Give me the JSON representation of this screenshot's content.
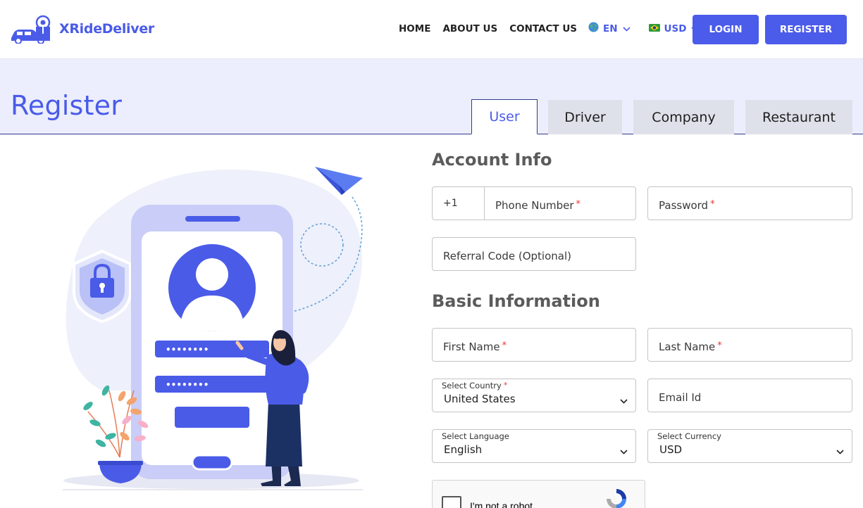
{
  "brand": {
    "name": "XRideDeliver"
  },
  "nav": {
    "home": "HOME",
    "about": "ABOUT US",
    "contact": "CONTACT US",
    "language": "EN",
    "currency": "USD",
    "login": "LOGIN",
    "register": "REGISTER"
  },
  "page": {
    "title": "Register"
  },
  "tabs": [
    {
      "label": "User",
      "active": true
    },
    {
      "label": "Driver",
      "active": false
    },
    {
      "label": "Company",
      "active": false
    },
    {
      "label": "Restaurant",
      "active": false
    }
  ],
  "account_info": {
    "heading": "Account Info",
    "phone_code": "+1",
    "phone_placeholder": "Phone Number",
    "password_placeholder": "Password",
    "referral_placeholder": "Referral Code (Optional)"
  },
  "basic_info": {
    "heading": "Basic Information",
    "first_name_placeholder": "First Name",
    "last_name_placeholder": "Last Name",
    "country_label": "Select Country",
    "country_value": "United States",
    "email_placeholder": "Email Id",
    "language_label": "Select Language",
    "language_value": "English",
    "currency_label": "Select Currency",
    "currency_value": "USD"
  },
  "captcha": {
    "label": "I'm not a robot"
  },
  "illustration": {
    "password_mask_1": "••••••••",
    "password_mask_2": "••••••••"
  },
  "colors": {
    "accent": "#4b5bea",
    "banner": "#eceefd",
    "tab_inactive": "#dfe1ea",
    "required": "#e53935"
  }
}
